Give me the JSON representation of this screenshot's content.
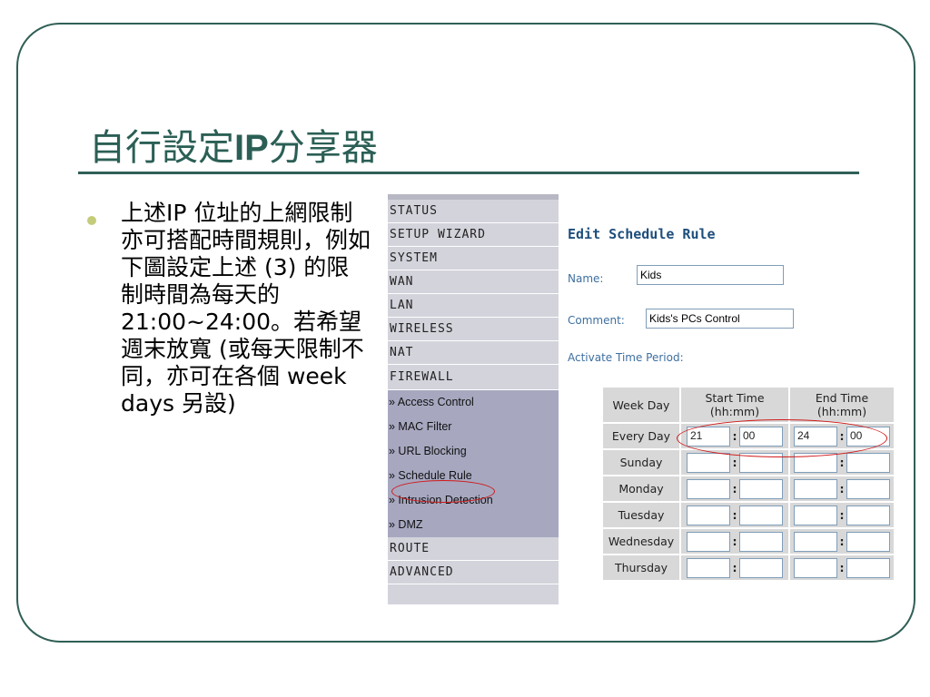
{
  "slide": {
    "title_prefix": "自行設定",
    "title_bold": "IP",
    "title_suffix": "分享器",
    "bullet": "上述IP 位址的上網限制亦可搭配時間規則，例如下圖設定上述 (3) 的限制時間為每天的21:00~24:00。若希望週末放寬 (或每天限制不同，亦可在各個 week days 另設)"
  },
  "nav": {
    "items_top": [
      "STATUS",
      "SETUP WIZARD",
      "SYSTEM",
      "WAN",
      "LAN",
      "WIRELESS",
      "NAT",
      "FIREWALL"
    ],
    "firewall_sub": [
      "» Access Control",
      "» MAC Filter",
      "» URL Blocking",
      "» Schedule Rule",
      "» Intrusion Detection",
      "» DMZ"
    ],
    "items_bottom": [
      "ROUTE",
      "ADVANCED"
    ]
  },
  "form": {
    "heading": "Edit Schedule Rule",
    "name_label": "Name:",
    "name_value": "Kids",
    "comment_label": "Comment:",
    "comment_value": "Kids's PCs Control",
    "period_label": "Activate Time Period:"
  },
  "schedule": {
    "headers": [
      "Week Day",
      "Start Time\n(hh:mm)",
      "End Time\n(hh:mm)"
    ],
    "colon": ":",
    "rows": [
      {
        "day": "Every Day",
        "sh": "21",
        "sm": "00",
        "eh": "24",
        "em": "00"
      },
      {
        "day": "Sunday",
        "sh": "",
        "sm": "",
        "eh": "",
        "em": ""
      },
      {
        "day": "Monday",
        "sh": "",
        "sm": "",
        "eh": "",
        "em": ""
      },
      {
        "day": "Tuesday",
        "sh": "",
        "sm": "",
        "eh": "",
        "em": ""
      },
      {
        "day": "Wednesday",
        "sh": "",
        "sm": "",
        "eh": "",
        "em": ""
      },
      {
        "day": "Thursday",
        "sh": "",
        "sm": "",
        "eh": "",
        "em": ""
      }
    ]
  },
  "colors": {
    "frame": "#2f5f56",
    "title": "#2b5f55",
    "bullet_dot": "#c4cc7a",
    "highlight": "#d01818"
  }
}
